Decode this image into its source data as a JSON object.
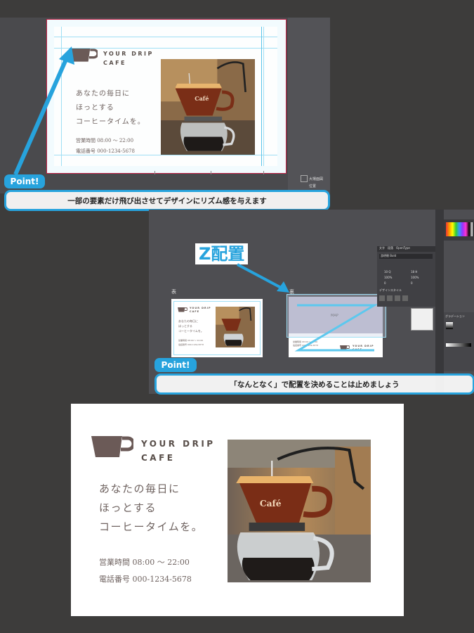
{
  "card": {
    "brand_line1": "YOUR DRIP",
    "brand_line2": "CAFE",
    "tagline": [
      "あなたの毎日に",
      "ほっとする",
      "コーヒータイムを。"
    ],
    "hours": "営業時間 08:00 〜 22:00",
    "phone": "電話番号 000-1234-5678",
    "photo_sign": "Café"
  },
  "colors": {
    "accent": "#27a3dd",
    "logo": "#6b5a57",
    "background": "#3d3c3b",
    "app_canvas": "#4e4e52"
  },
  "section1": {
    "badge": "Point!",
    "caption": "一部の要素だけ飛び出させてデザインにリズム感を与えます",
    "side_panel_labels": [
      "大場面図",
      "位置"
    ]
  },
  "section2": {
    "z_label": "Z配置",
    "front_label": "表",
    "back_label": "裏",
    "badge": "Point!",
    "caption": "「なんとなく」で配置を決めることは止めましょう",
    "back_placeholder": "MAP",
    "panel_tabs": [
      "文字",
      "段落",
      "OpenType"
    ],
    "font_name": "游明朝 Bold",
    "size_value": "10 Q",
    "leading_value": "18 H",
    "scale_h": "100%",
    "scale_v": "100%",
    "tracking": "0",
    "kerning": "0",
    "gradient_label": "グラデーション",
    "char_style_label": "デザインスタイル"
  }
}
